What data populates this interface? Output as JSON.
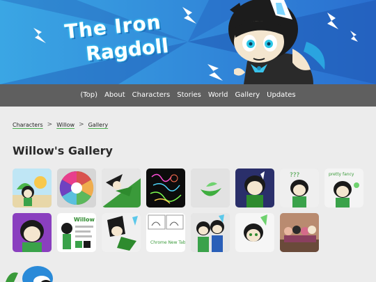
{
  "site": {
    "logo_line1": "The Iron",
    "logo_line2": "Ragdoll"
  },
  "nav": {
    "items": [
      {
        "label": "(Top)"
      },
      {
        "label": "About"
      },
      {
        "label": "Characters"
      },
      {
        "label": "Stories"
      },
      {
        "label": "World"
      },
      {
        "label": "Gallery"
      },
      {
        "label": "Updates"
      }
    ]
  },
  "breadcrumb": {
    "items": [
      "Characters",
      "Willow",
      "Gallery"
    ],
    "separator": ">"
  },
  "page": {
    "title": "Willow's Gallery"
  },
  "gallery": {
    "items": [
      {
        "name": "gallery-thumb-1",
        "art": "willow-beach"
      },
      {
        "name": "gallery-thumb-2",
        "art": "color-wheel"
      },
      {
        "name": "gallery-thumb-3",
        "art": "willow-flying"
      },
      {
        "name": "gallery-thumb-4",
        "art": "neon-sketch"
      },
      {
        "name": "gallery-thumb-5",
        "art": "green-leaf"
      },
      {
        "name": "gallery-thumb-6",
        "art": "willow-dark"
      },
      {
        "name": "gallery-thumb-7",
        "art": "willow-question",
        "caption": "???"
      },
      {
        "name": "gallery-thumb-8",
        "art": "willow-doodle",
        "caption": "pretty fancy"
      },
      {
        "name": "gallery-thumb-9",
        "art": "willow-purple"
      },
      {
        "name": "gallery-thumb-10",
        "art": "reference-sheet",
        "caption": "Willow"
      },
      {
        "name": "gallery-thumb-11",
        "art": "willow-pose"
      },
      {
        "name": "gallery-thumb-12",
        "art": "comic",
        "caption": "Chrome New Tab!"
      },
      {
        "name": "gallery-thumb-13",
        "art": "duo"
      },
      {
        "name": "gallery-thumb-14",
        "art": "willow-face"
      },
      {
        "name": "gallery-thumb-15",
        "art": "group-photo"
      }
    ]
  },
  "colors": {
    "banner_light": "#3a9be0",
    "banner_dark": "#1f5fb8",
    "nav_bg": "#5f5f5f",
    "accent_green": "#4caf50",
    "page_bg": "#ececec"
  }
}
